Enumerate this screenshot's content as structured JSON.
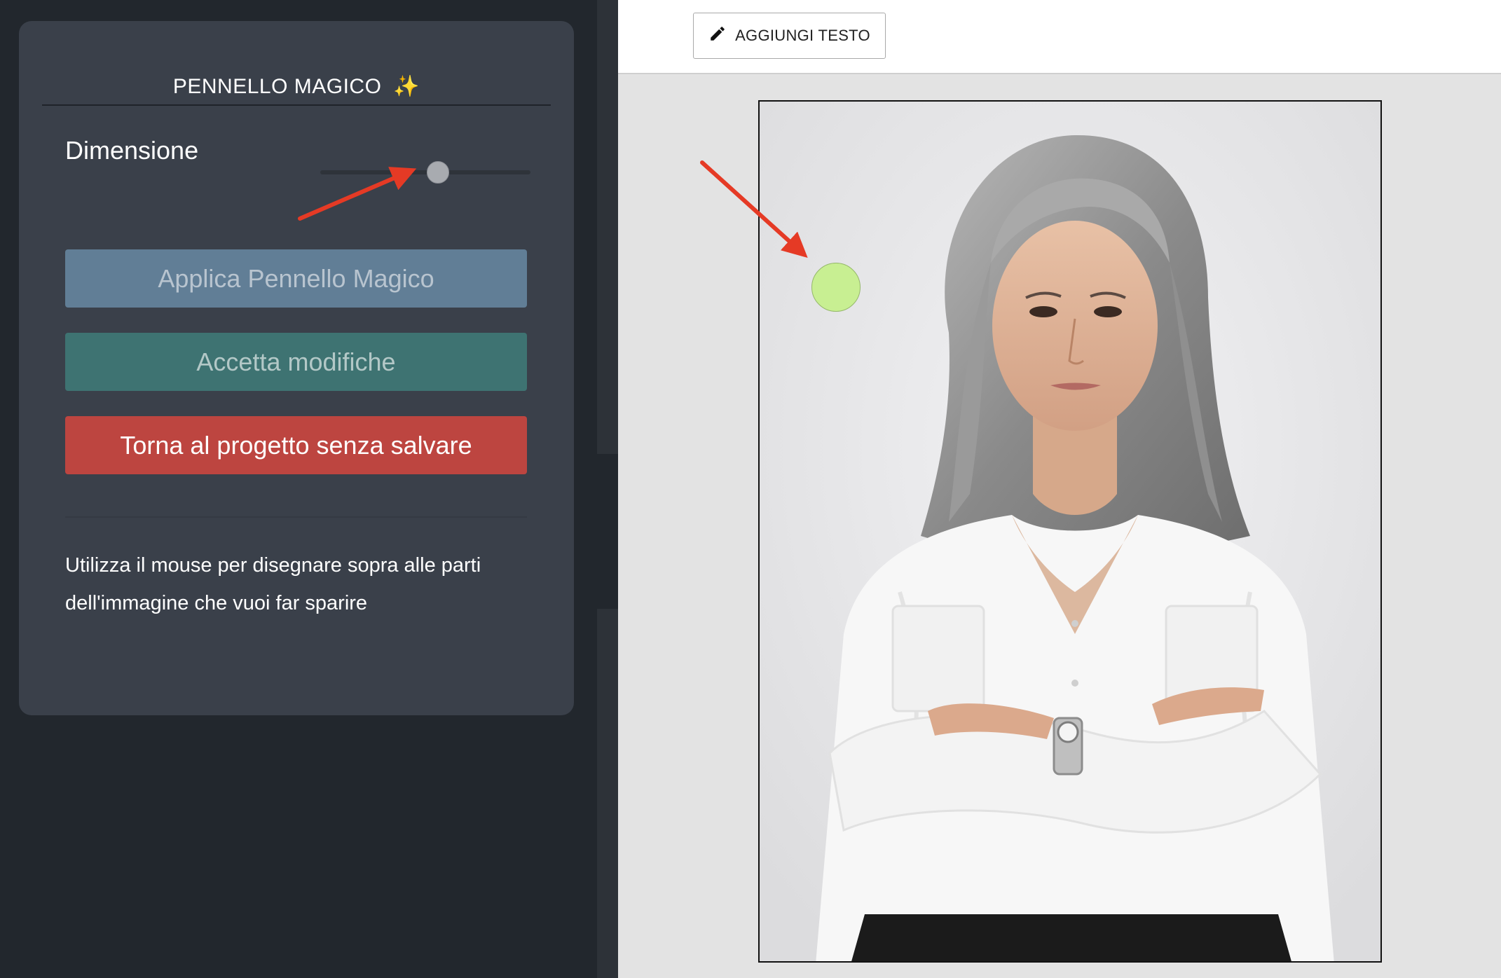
{
  "sidebar": {
    "title": "PENNELLO MAGICO",
    "title_emoji": "✨",
    "size_label": "Dimensione",
    "buttons": {
      "apply": "Applica Pennello Magico",
      "accept": "Accetta modifiche",
      "back": "Torna al progetto senza salvare"
    },
    "help_text": "Utilizza il mouse per disegnare sopra alle parti dell'immagine che vuoi far sparire",
    "slider_value_fraction": 0.56
  },
  "toolbar": {
    "add_text_label": "AGGIUNGI TESTO",
    "add_text_icon": "pencil-icon"
  },
  "collapse_icon": "chevron-left-icon",
  "colors": {
    "sidebar_bg": "#22272d",
    "panel_bg": "#3a404a",
    "apply_button": "#617e96",
    "accept_button": "#3e7372",
    "back_button": "#bd4540",
    "brush_cursor": "#c8ef92",
    "annotation_arrow": "#e53a25"
  }
}
